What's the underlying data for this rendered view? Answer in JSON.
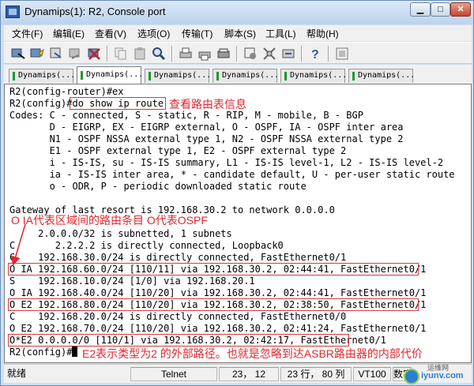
{
  "window": {
    "title": "Dynamips(1): R2, Console port"
  },
  "menu": [
    "文件(F)",
    "编辑(E)",
    "查看(V)",
    "选项(O)",
    "传输(T)",
    "脚本(S)",
    "工具(L)",
    "帮助(H)"
  ],
  "tabs": [
    {
      "label": "Dynamips(...",
      "active": false
    },
    {
      "label": "Dynamips(...",
      "active": true
    },
    {
      "label": "Dynamips(...",
      "active": false
    },
    {
      "label": "Dynamips(...",
      "active": false
    },
    {
      "label": "Dynamips(...",
      "active": false
    },
    {
      "label": "Dynamips(...",
      "active": false
    }
  ],
  "terminal": {
    "lines": [
      "R2(config-router)#ex",
      "R2(config)#do show ip route",
      "Codes: C - connected, S - static, R - RIP, M - mobile, B - BGP",
      "       D - EIGRP, EX - EIGRP external, O - OSPF, IA - OSPF inter area",
      "       N1 - OSPF NSSA external type 1, N2 - OSPF NSSA external type 2",
      "       E1 - OSPF external type 1, E2 - OSPF external type 2",
      "       i - IS-IS, su - IS-IS summary, L1 - IS-IS level-1, L2 - IS-IS level-2",
      "       ia - IS-IS inter area, * - candidate default, U - per-user static route",
      "       o - ODR, P - periodic downloaded static route",
      "",
      "Gateway of last resort is 192.168.30.2 to network 0.0.0.0",
      "",
      "     2.0.0.0/32 is subnetted, 1 subnets",
      "C       2.2.2.2 is directly connected, Loopback0",
      "C    192.168.30.0/24 is directly connected, FastEthernet0/1",
      "O IA 192.168.60.0/24 [110/11] via 192.168.30.2, 02:44:41, FastEthernet0/1",
      "S    192.168.10.0/24 [1/0] via 192.168.20.1",
      "O IA 192.168.40.0/24 [110/20] via 192.168.30.2, 02:44:41, FastEthernet0/1",
      "O E2 192.168.80.0/24 [110/20] via 192.168.30.2, 02:38:50, FastEthernet0/1",
      "C    192.168.20.0/24 is directly connected, FastEthernet0/0",
      "O E2 192.168.70.0/24 [110/20] via 192.168.30.2, 02:41:24, FastEthernet0/1",
      "O*E2 0.0.0.0/0 [110/1] via 192.168.30.2, 02:42:17, FastEthernet0/1",
      "R2(config)#"
    ]
  },
  "annotations": {
    "route_table": "查看路由表信息",
    "o_ia": "O IA代表区域间的路由条目  O代表OSPF",
    "e2": "E2表示类型为2 的外部路径。也就是忽略到达ASBR路由器的内部代价"
  },
  "statusbar": {
    "state": "就绪",
    "protocol": "Telnet",
    "position": "23， 12",
    "size": "23 行， 80 列",
    "terminal_type": "VT100",
    "caps": "数字"
  },
  "watermark": {
    "brand": "运维网",
    "domain": "iyunv.com"
  },
  "colors": {
    "annotation": "#e0262e",
    "tab_indicator": "#1d9a2a",
    "titlebar": "#c9dcf1"
  }
}
